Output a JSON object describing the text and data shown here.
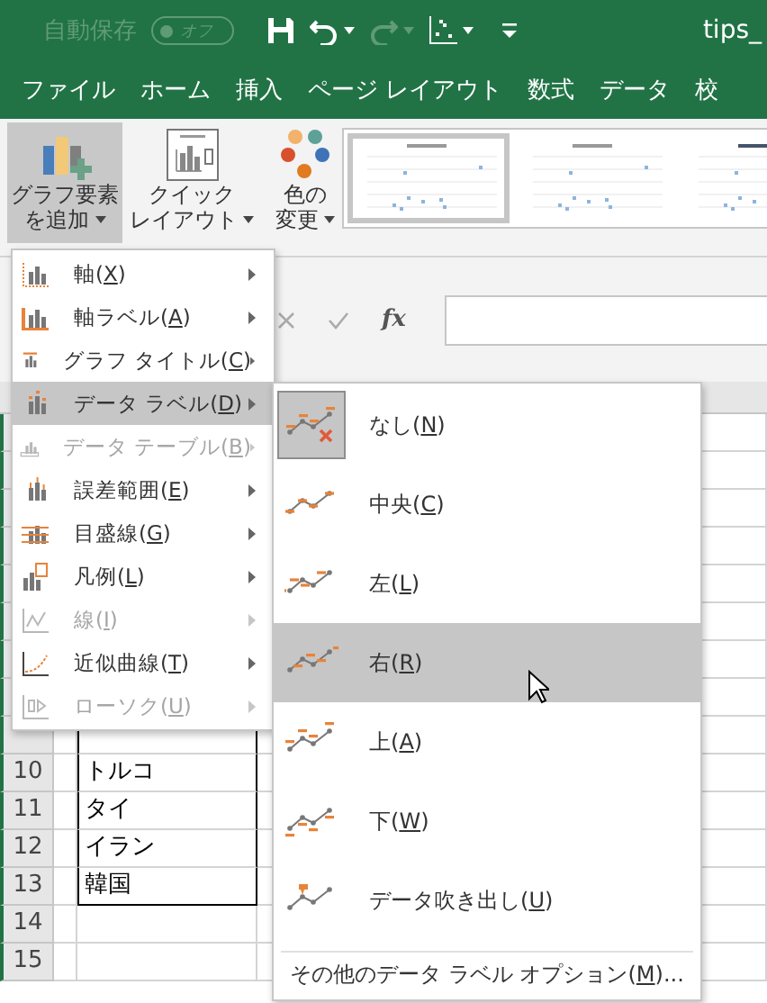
{
  "title_bar": {
    "autosave_label": "自動保存",
    "autosave_toggle": {
      "label": "オフ",
      "on": false
    },
    "file_name": "tips_"
  },
  "ribbon_tabs": [
    {
      "label": "ファイル",
      "selected": false
    },
    {
      "label": "ホーム",
      "selected": false
    },
    {
      "label": "挿入",
      "selected": false
    },
    {
      "label": "ページ レイアウト",
      "selected": false
    },
    {
      "label": "数式",
      "selected": false
    },
    {
      "label": "データ",
      "selected": false
    },
    {
      "label": "校",
      "selected": false
    }
  ],
  "ribbon": {
    "buttons": [
      {
        "lines": [
          "グラフ要素",
          "を追加"
        ],
        "selected": true
      },
      {
        "lines": [
          "クイック",
          "レイアウト"
        ],
        "selected": false
      },
      {
        "lines": [
          "色の",
          "変更"
        ],
        "selected": false
      }
    ],
    "chart_styles": [
      {
        "selected": true
      },
      {
        "selected": false
      },
      {
        "selected": false
      }
    ]
  },
  "formula_bar": {
    "function_label": "fx"
  },
  "sheet": {
    "rows": [
      {
        "number": "10",
        "cell_b": "トルコ"
      },
      {
        "number": "11",
        "cell_b": "タイ"
      },
      {
        "number": "12",
        "cell_b": "イラン"
      },
      {
        "number": "13",
        "cell_b": "韓国"
      },
      {
        "number": "14"
      },
      {
        "number": "15"
      }
    ]
  },
  "chart_elements_menu": {
    "items": [
      {
        "label": "軸(",
        "key": "X",
        "suffix": ")",
        "disabled": false,
        "selected": false
      },
      {
        "label": "軸ラベル(",
        "key": "A",
        "suffix": ")",
        "disabled": false,
        "selected": false
      },
      {
        "label": "グラフ タイトル(",
        "key": "C",
        "suffix": ")",
        "disabled": false,
        "selected": false
      },
      {
        "label": "データ ラベル(",
        "key": "D",
        "suffix": ")",
        "disabled": false,
        "selected": true
      },
      {
        "label": "データ テーブル(",
        "key": "B",
        "suffix": ")",
        "disabled": true,
        "selected": false
      },
      {
        "label": "誤差範囲(",
        "key": "E",
        "suffix": ")",
        "disabled": false,
        "selected": false
      },
      {
        "label": "目盛線(",
        "key": "G",
        "suffix": ")",
        "disabled": false,
        "selected": false
      },
      {
        "label": "凡例(",
        "key": "L",
        "suffix": ")",
        "disabled": false,
        "selected": false
      },
      {
        "label": "線(",
        "key": "I",
        "suffix": ")",
        "disabled": true,
        "selected": false
      },
      {
        "label": "近似曲線(",
        "key": "T",
        "suffix": ")",
        "disabled": false,
        "selected": false
      },
      {
        "label": "ローソク(",
        "key": "U",
        "suffix": ")",
        "disabled": true,
        "selected": false
      }
    ]
  },
  "data_labels_submenu": {
    "items": [
      {
        "label": "なし(",
        "key": "N",
        "suffix": ")",
        "checked": true,
        "selected": false
      },
      {
        "label": "中央(",
        "key": "C",
        "suffix": ")",
        "checked": false,
        "selected": false
      },
      {
        "label": "左(",
        "key": "L",
        "suffix": ")",
        "checked": false,
        "selected": false
      },
      {
        "label": "右(",
        "key": "R",
        "suffix": ")",
        "checked": false,
        "selected": true
      },
      {
        "label": "上(",
        "key": "A",
        "suffix": ")",
        "checked": false,
        "selected": false
      },
      {
        "label": "下(",
        "key": "W",
        "suffix": ")",
        "checked": false,
        "selected": false
      },
      {
        "label": "データ吹き出し(",
        "key": "U",
        "suffix": ")",
        "checked": false,
        "selected": false
      }
    ],
    "more_options": {
      "label": "その他のデータ ラベル オプション(",
      "key": "M",
      "suffix": ")..."
    }
  }
}
